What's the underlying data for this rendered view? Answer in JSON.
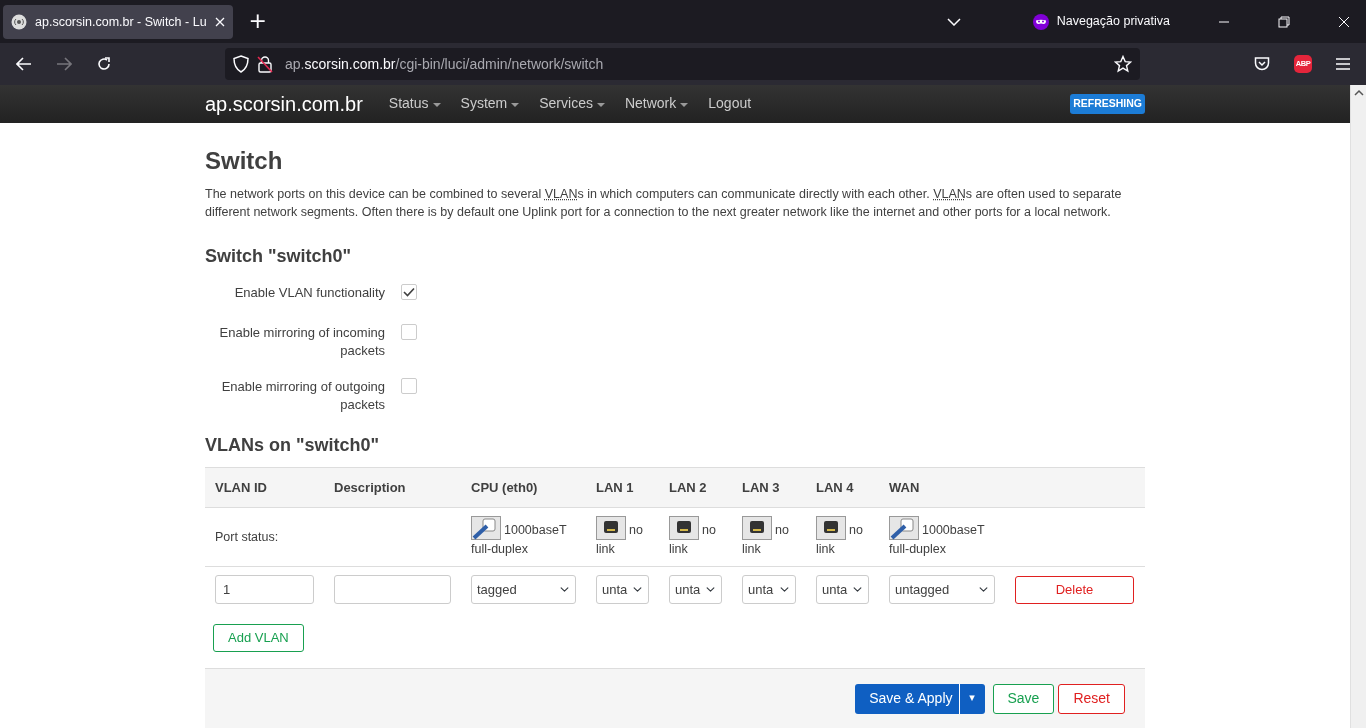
{
  "browser": {
    "tab": {
      "title": "ap.scorsin.com.br - Switch - Lu",
      "selected": true
    },
    "new_tab": "+",
    "private_label": "Navegação privativa",
    "url_parts": [
      {
        "text": "ap.",
        "highlight": false
      },
      {
        "text": "scorsin.com.br",
        "highlight": true
      },
      {
        "text": "/cgi-bin/luci/admin/network/switch",
        "highlight": false
      }
    ],
    "adblock_label": "ABP"
  },
  "navbar": {
    "brand": "ap.scorsin.com.br",
    "menu": [
      {
        "label": "Status",
        "dropdown": true
      },
      {
        "label": "System",
        "dropdown": true
      },
      {
        "label": "Services",
        "dropdown": true
      },
      {
        "label": "Network",
        "dropdown": true
      },
      {
        "label": "Logout",
        "dropdown": false
      }
    ],
    "badge": "REFRESHING"
  },
  "page": {
    "title": "Switch",
    "description": [
      {
        "text": "The network ports on this device can be combined to several ",
        "abbr": false
      },
      {
        "text": "VLAN",
        "abbr": true
      },
      {
        "text": "s in which computers can communicate directly with each other. ",
        "abbr": false
      },
      {
        "text": "VLAN",
        "abbr": true
      },
      {
        "text": "s are often used to separate different network segments. Often there is by default one Uplink port for a connection to the next greater network like the internet and other ports for a local network.",
        "abbr": false
      }
    ],
    "switch_heading": "Switch \"switch0\"",
    "options": [
      {
        "label": "Enable VLAN functionality",
        "checked": true
      },
      {
        "label": "Enable mirroring of incoming packets",
        "checked": false
      },
      {
        "label": "Enable mirroring of outgoing packets",
        "checked": false
      }
    ],
    "vlans_heading": "VLANs on \"switch0\"",
    "table": {
      "columns": [
        "VLAN ID",
        "Description",
        "CPU (eth0)",
        "LAN 1",
        "LAN 2",
        "LAN 3",
        "LAN 4",
        "WAN"
      ],
      "port_status_label": "Port status:",
      "ports": [
        {
          "kind": "linked",
          "line1": "1000baseT",
          "line2": "full-duplex"
        },
        {
          "kind": "nolink",
          "line1": "no",
          "line2": "link"
        },
        {
          "kind": "nolink",
          "line1": "no",
          "line2": "link"
        },
        {
          "kind": "nolink",
          "line1": "no",
          "line2": "link"
        },
        {
          "kind": "nolink",
          "line1": "no",
          "line2": "link"
        },
        {
          "kind": "linked",
          "line1": "1000baseT",
          "line2": "full-duplex"
        }
      ],
      "rows": [
        {
          "vlan_id": "1",
          "port_modes": [
            "tagged",
            "unta",
            "unta",
            "unta",
            "unta",
            "untagged"
          ],
          "delete": "Delete"
        }
      ]
    },
    "add_button": "Add VLAN",
    "footer": {
      "save_apply": "Save & Apply",
      "split": "▾",
      "save": "Save",
      "reset": "Reset"
    }
  }
}
